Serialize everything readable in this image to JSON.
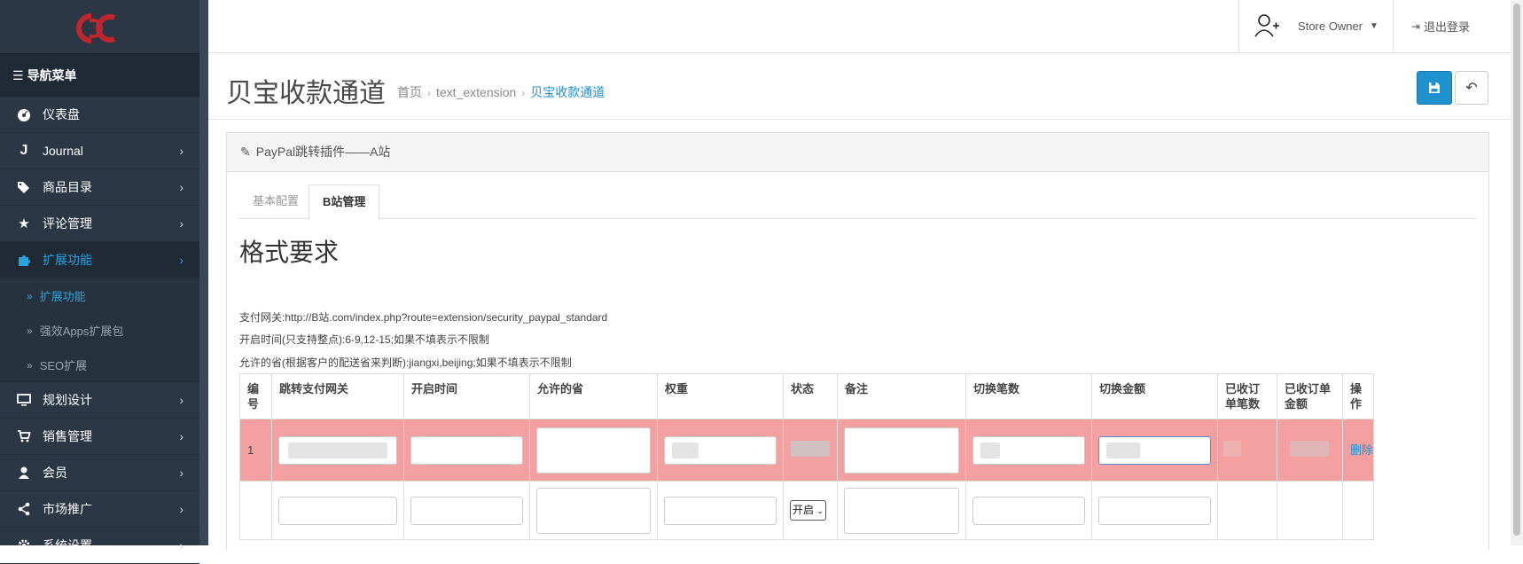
{
  "sidebar": {
    "logo_text": "OC",
    "nav_title": "导航菜单",
    "menu": [
      {
        "label": "仪表盘",
        "icon": "dashboard-icon",
        "has_children": false
      },
      {
        "label": "Journal",
        "icon": "journal-icon",
        "has_children": true
      },
      {
        "label": "商品目录",
        "icon": "tags-icon",
        "has_children": true
      },
      {
        "label": "评论管理",
        "icon": "star-icon",
        "has_children": true
      },
      {
        "label": "扩展功能",
        "icon": "puzzle-icon",
        "has_children": true,
        "active": true
      },
      {
        "label": "规划设计",
        "icon": "monitor-icon",
        "has_children": true
      },
      {
        "label": "销售管理",
        "icon": "cart-icon",
        "has_children": true
      },
      {
        "label": "会员",
        "icon": "user-icon",
        "has_children": true
      },
      {
        "label": "市场推广",
        "icon": "share-icon",
        "has_children": true
      },
      {
        "label": "系统设置",
        "icon": "gear-icon",
        "has_children": true
      }
    ],
    "submenu": [
      {
        "label": "扩展功能",
        "active": true
      },
      {
        "label": "强效Apps扩展包",
        "active": false
      },
      {
        "label": "SEO扩展",
        "active": false
      }
    ]
  },
  "header": {
    "user_name": "Store Owner",
    "logout_label": "退出登录"
  },
  "page": {
    "title": "贝宝收款通道",
    "breadcrumb": [
      "首页",
      "text_extension",
      "贝宝收款通道"
    ]
  },
  "panel": {
    "heading": "PayPal跳转插件——A站",
    "tabs": [
      {
        "label": "基本配置",
        "active": false
      },
      {
        "label": "B站管理",
        "active": true
      }
    ],
    "format_title": "格式要求",
    "info_lines": [
      "支付网关:http://B站.com/index.php?route=extension/security_paypal_standard",
      "开启时间(只支持整点):6-9,12-15;如果不填表示不限制",
      "允许的省(根据客户的配送省来判断):jiangxi,beijing;如果不填表示不限制"
    ]
  },
  "table": {
    "headers": [
      "编号",
      "跳转支付网关",
      "开启时间",
      "允许的省",
      "权重",
      "状态",
      "备注",
      "切换笔数",
      "切换金额",
      "已收订单笔数",
      "已收订单金额",
      "操作"
    ],
    "rows": [
      {
        "id": "1",
        "action_label": "删除",
        "highlighted": true
      }
    ],
    "new_row": {
      "status_value": "开启"
    }
  },
  "colors": {
    "sidebar_bg": "#2b3744",
    "accent": "#1e91cf",
    "row_highlight": "#f4a0a0",
    "logo": "#c0272d"
  }
}
